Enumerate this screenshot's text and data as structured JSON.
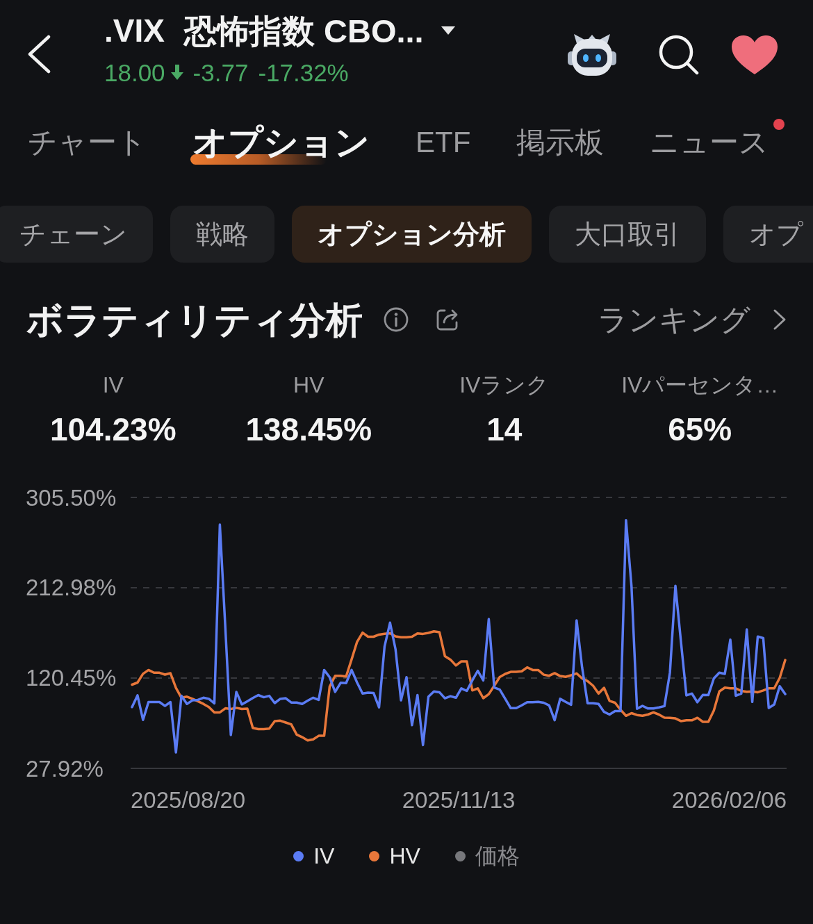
{
  "header": {
    "symbol": ".VIX",
    "name": "恐怖指数 CBO...",
    "price": "18.00",
    "down": true,
    "change": "-3.77",
    "change_percent": "-17.32%"
  },
  "tabs": [
    {
      "label": "チャート",
      "selected": false,
      "dot": false
    },
    {
      "label": "オプション",
      "selected": true,
      "dot": false
    },
    {
      "label": "ETF",
      "selected": false,
      "dot": false
    },
    {
      "label": "掲示板",
      "selected": false,
      "dot": false
    },
    {
      "label": "ニュース",
      "selected": false,
      "dot": true
    }
  ],
  "subtabs": [
    {
      "label": "チェーン",
      "selected": false
    },
    {
      "label": "戦略",
      "selected": false
    },
    {
      "label": "オプション分析",
      "selected": true
    },
    {
      "label": "大口取引",
      "selected": false
    },
    {
      "label": "オプ",
      "selected": false
    }
  ],
  "volatility": {
    "title": "ボラティリティ分析",
    "ranking_link": "ランキング",
    "stats": [
      {
        "label": "IV",
        "value": "104.23%"
      },
      {
        "label": "HV",
        "value": "138.45%"
      },
      {
        "label": "IVランク",
        "value": "14"
      },
      {
        "label": "IVパーセンタ…",
        "value": "65%"
      }
    ],
    "chart_data": {
      "type": "line",
      "ylim": [
        27.92,
        305.5
      ],
      "yticks": [
        {
          "value": 305.5,
          "label": "305.50%"
        },
        {
          "value": 212.98,
          "label": "212.98%"
        },
        {
          "value": 120.45,
          "label": "120.45%"
        },
        {
          "value": 27.92,
          "label": "27.92%"
        }
      ],
      "series": [
        {
          "name": "IV",
          "color": "#5b7cf4",
          "values": [
            90.7,
            102.7,
            77.6,
            95.9,
            95.9,
            95.9,
            91.8,
            95.9,
            44.3,
            102.2,
            94.0,
            97.6,
            98.1,
            100.3,
            99.2,
            94.5,
            277.7,
            171.8,
            62.1,
            106.3,
            93.5,
            96.7,
            100.0,
            103.0,
            100.8,
            102.2,
            94.8,
            99.2,
            99.7,
            95.4,
            95.4,
            94.0,
            97.3,
            100.3,
            98.1,
            128.7,
            121.3,
            106.3,
            115.6,
            115.3,
            128.7,
            115.8,
            104.6,
            105.5,
            105.2,
            90.5,
            152.7,
            177.2,
            150.0,
            97.6,
            121.3,
            72.2,
            103.0,
            51.8,
            101.4,
            106.7,
            105.9,
            99.7,
            101.9,
            100.3,
            109.9,
            107.3,
            118.0,
            127.9,
            118.0,
            180.9,
            110.7,
            108.6,
            99.2,
            89.6,
            89.6,
            92.5,
            95.7,
            95.7,
            96.0,
            95.2,
            92.5,
            77.3,
            99.2,
            96.0,
            93.1,
            179.6,
            131.4,
            94.7,
            94.7,
            93.9,
            85.8,
            83.1,
            86.6,
            86.6,
            282.2,
            214.4,
            89.0,
            92.0,
            89.3,
            89.3,
            90.4,
            91.7,
            126.0,
            215.0,
            158.2,
            102.7,
            104.6,
            95.7,
            103.2,
            103.0,
            120.1,
            126.0,
            124.7,
            159.8,
            102.4,
            104.6,
            170.2,
            96.0,
            163.0,
            161.4,
            89.8,
            93.3,
            112.1,
            104.0
          ]
        },
        {
          "name": "HV",
          "color": "#e8773a",
          "values": [
            113.7,
            115.8,
            124.8,
            128.7,
            125.9,
            125.9,
            124.0,
            125.4,
            110.4,
            100.3,
            101.4,
            99.2,
            96.7,
            94.0,
            90.7,
            85.3,
            85.3,
            89.4,
            88.8,
            89.9,
            88.8,
            89.1,
            69.4,
            68.1,
            68.1,
            68.6,
            76.3,
            76.8,
            74.9,
            73.0,
            62.6,
            59.9,
            56.6,
            57.7,
            61.3,
            61.3,
            111.7,
            122.7,
            122.7,
            122.1,
            139.6,
            157.6,
            166.9,
            162.8,
            162.8,
            165.0,
            165.8,
            166.3,
            163.1,
            162.2,
            162.2,
            162.8,
            166.2,
            165.7,
            166.7,
            168.3,
            167.5,
            142.9,
            139.4,
            133.3,
            137.5,
            137.5,
            107.8,
            109.9,
            99.8,
            104.0,
            112.6,
            121.5,
            124.7,
            126.8,
            126.8,
            127.4,
            131.4,
            128.7,
            128.7,
            123.9,
            122.8,
            125.5,
            122.5,
            121.7,
            123.3,
            125.2,
            120.1,
            117.4,
            112.6,
            104.6,
            110.5,
            97.1,
            95.2,
            88.0,
            81.8,
            84.5,
            82.6,
            81.8,
            83.1,
            85.3,
            83.1,
            79.9,
            79.7,
            79.1,
            76.4,
            77.2,
            77.2,
            79.7,
            75.6,
            75.6,
            87.2,
            106.7,
            110.7,
            109.9,
            109.9,
            107.3,
            106.4,
            106.7,
            105.9,
            107.8,
            109.9,
            109.9,
            120.6,
            138.9
          ]
        }
      ]
    },
    "x_axis_labels": [
      "2025/08/20",
      "2025/11/13",
      "2026/02/06"
    ],
    "legend": [
      {
        "on": true
      },
      {
        "on": true
      },
      {
        "label": "価格",
        "color": "#77787c",
        "on": false
      }
    ]
  }
}
